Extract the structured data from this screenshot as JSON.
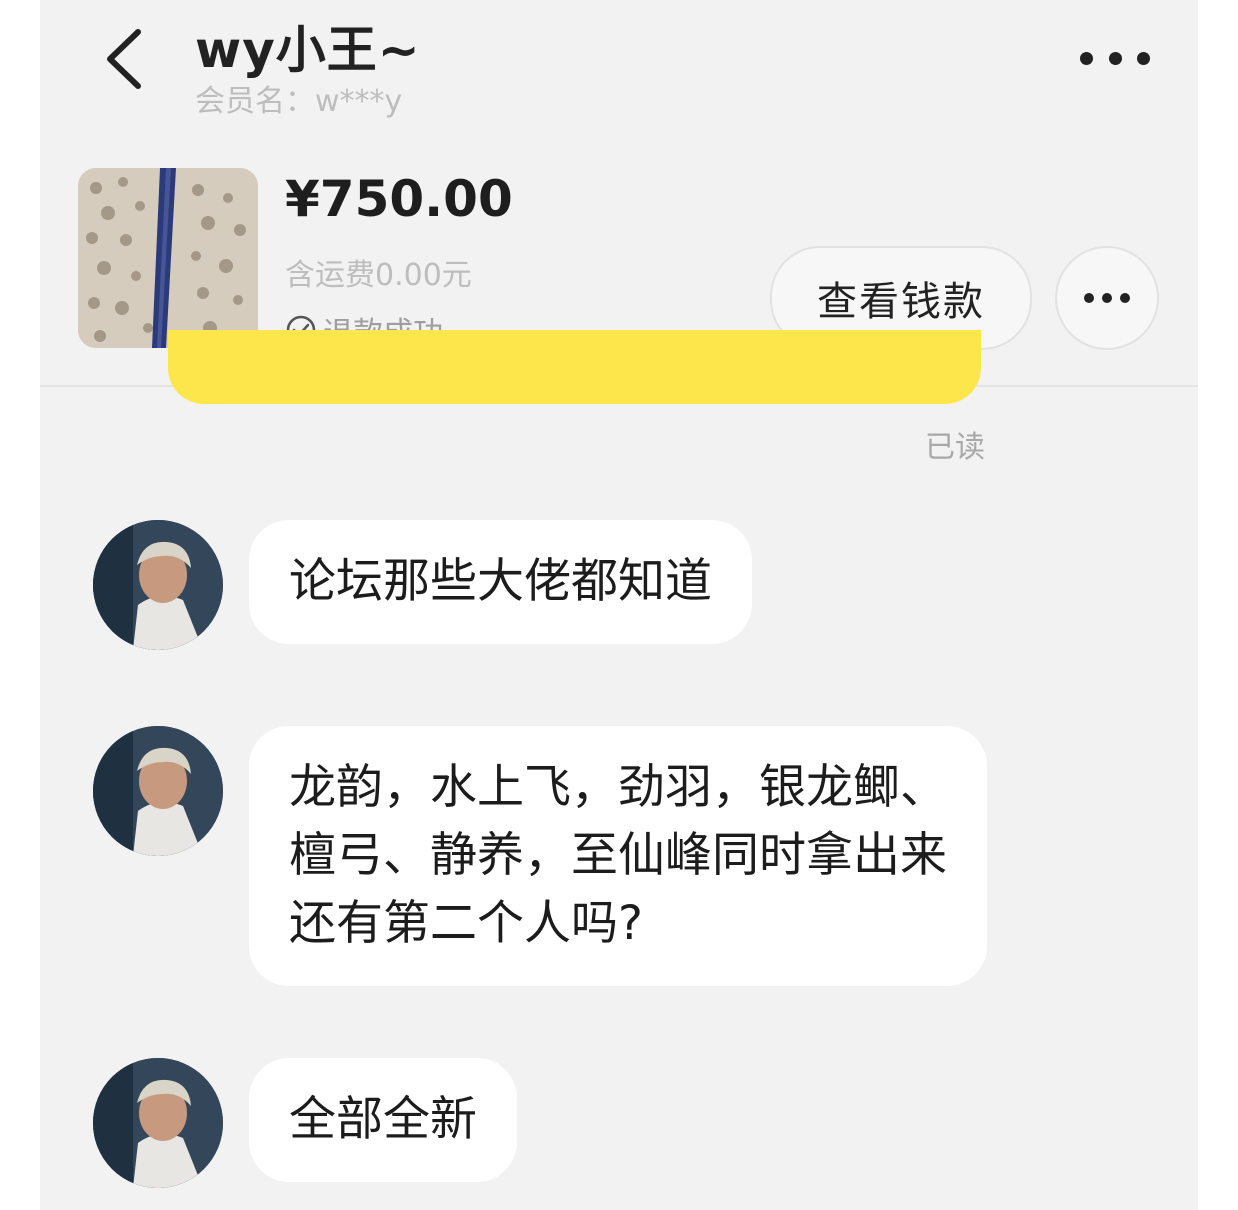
{
  "header": {
    "title": "wy小王~",
    "subtitle": "会员名：w***y"
  },
  "product": {
    "price": "¥750.00",
    "shipping": "含运费0.00元",
    "status": "退款成功",
    "view_money_button": "查看钱款"
  },
  "read_status": "已读",
  "messages": [
    {
      "text": "论坛那些大佬都知道"
    },
    {
      "text": "龙韵，水上飞，劲羽，银龙鲫、\n檀弓、静养，至仙峰同时拿出来\n还有第二个人吗?"
    },
    {
      "text": "全部全新"
    }
  ],
  "colors": {
    "background": "#f2f2f2",
    "sent_bubble": "#fde54c",
    "received_bubble": "#ffffff",
    "muted_text": "#bdbdbd"
  },
  "icons": [
    "back-arrow-icon",
    "more-dots-icon",
    "check-circle-icon"
  ]
}
